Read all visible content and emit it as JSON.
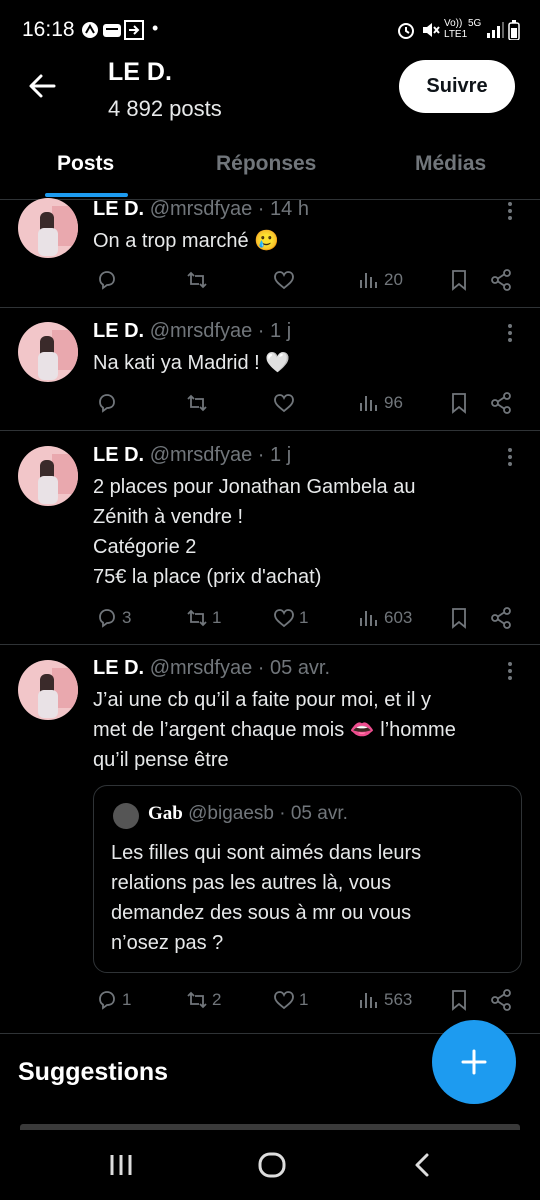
{
  "status_bar": {
    "time": "16:18",
    "right_text": "Vo)) LTE1",
    "network": "5G"
  },
  "header": {
    "name": "LE D.",
    "posts_count": "4 892 posts",
    "follow_label": "Suivre"
  },
  "tabs": [
    {
      "label": "Posts",
      "active": true
    },
    {
      "label": "Réponses",
      "active": false
    },
    {
      "label": "Médias",
      "active": false
    }
  ],
  "tweets": [
    {
      "name": "LE D.",
      "meta": "@mrsdfyae · 14 h",
      "text": "On a trop marché 🥲",
      "replies": "",
      "reposts": "",
      "likes": "",
      "views": "20"
    },
    {
      "name": "LE D.",
      "meta": "@mrsdfyae · 1 j",
      "text": "Na kati ya Madrid ! 🤍",
      "replies": "",
      "reposts": "",
      "likes": "",
      "views": "96"
    },
    {
      "name": "LE D.",
      "meta": "@mrsdfyae · 1 j",
      "text": "2 places pour Jonathan Gambela au\nZénith à vendre !\nCatégorie 2\n75€ la place (prix d'achat)",
      "replies": "3",
      "reposts": "1",
      "likes": "1",
      "views": "603"
    },
    {
      "name": "LE D.",
      "meta": "@mrsdfyae · 05 avr.",
      "text": "J’ai une cb qu’il a faite pour moi, et il y\nmet de l’argent chaque mois 👄 l’homme\nqu’il pense être",
      "replies": "1",
      "reposts": "2",
      "likes": "1",
      "views": "563",
      "quote": {
        "name": "Gab",
        "meta": "@bigaesb · 05 avr.",
        "text": "Les filles qui sont aimés dans leurs\nrelations pas les autres là, vous\ndemandez des sous à mr ou vous\nn’osez pas ?"
      }
    }
  ],
  "suggestions": {
    "title": "Suggestions"
  },
  "colors": {
    "accent": "#1d9bf0",
    "background": "#000000",
    "secondary_text": "#71767b",
    "divider": "#2f3336"
  }
}
